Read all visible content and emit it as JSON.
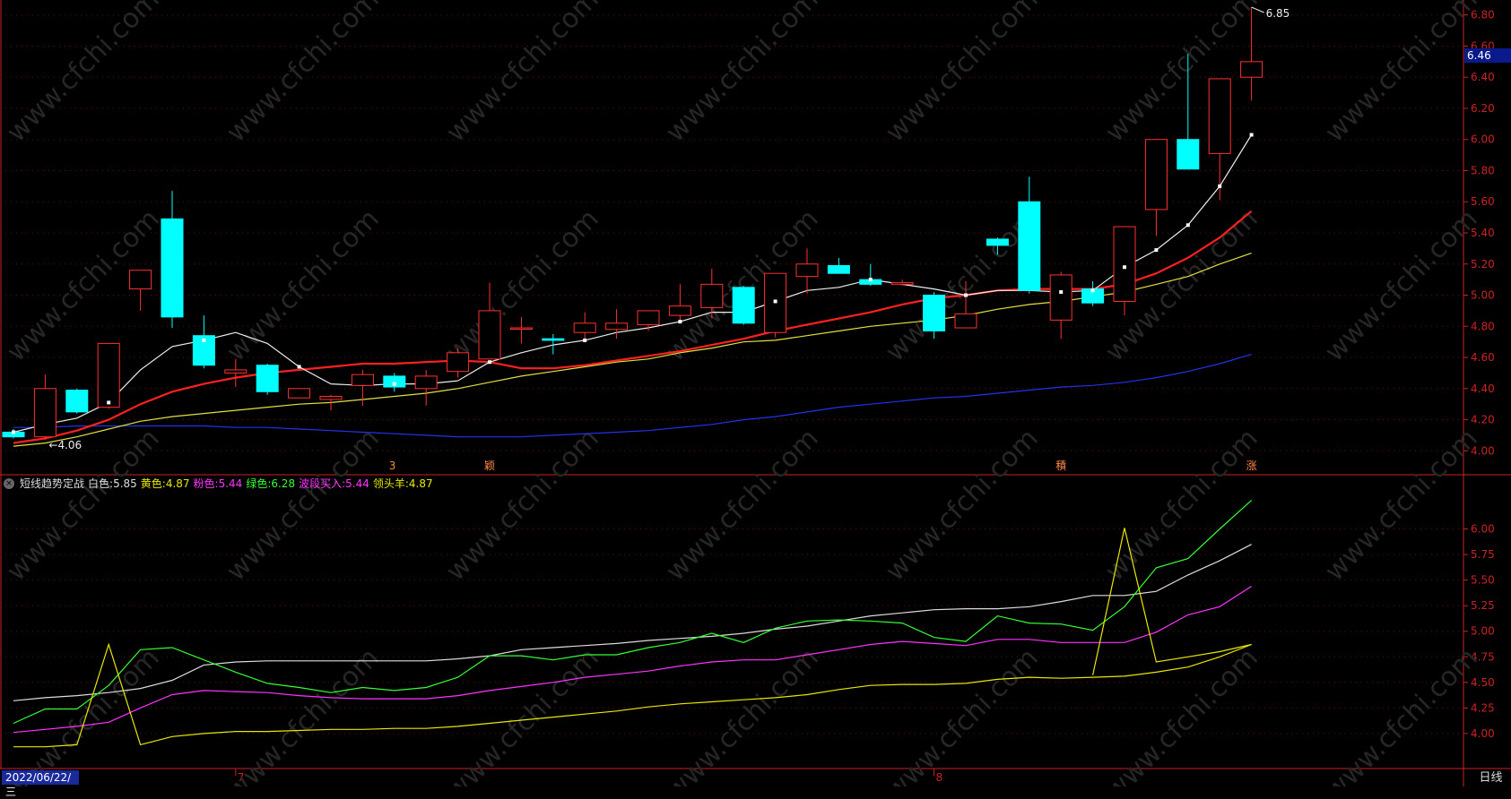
{
  "legend": {
    "title": "短线趋势定战",
    "items": [
      {
        "label": "白色:",
        "value": "5.85",
        "color": "#dddddd"
      },
      {
        "label": "黄色:",
        "value": "4.87",
        "color": "#e8e800"
      },
      {
        "label": "粉色:",
        "value": "5.44",
        "color": "#ff33ff"
      },
      {
        "label": "绿色:",
        "value": "6.28",
        "color": "#33ff33"
      },
      {
        "label": "波段买入:",
        "value": "5.44",
        "color": "#ff33ff"
      },
      {
        "label": "领头羊:",
        "value": "4.87",
        "color": "#e8e800"
      }
    ]
  },
  "date_label": "2022/06/22/三",
  "period_label": "日线",
  "current_price": "6.46",
  "colors": {
    "up": "#ff3030",
    "down": "#00ffff",
    "ma5": "#eeeeee",
    "ma10": "#ff2020",
    "ma20": "#e0e040",
    "ma60": "#2233ee",
    "axis": "#cc2222"
  },
  "chart_data": [
    {
      "type": "candlestick",
      "ylim": [
        3.95,
        6.85
      ],
      "y_ticks": [
        "6.80",
        "6.60",
        "6.40",
        "6.20",
        "6.00",
        "5.80",
        "5.60",
        "5.40",
        "5.20",
        "5.00",
        "4.80",
        "4.60",
        "4.40",
        "4.20",
        "4.00"
      ],
      "high_annotation": "6.85",
      "low_annotation": "4.06",
      "ohlc": [
        [
          4.12,
          4.14,
          4.08,
          4.09
        ],
        [
          4.09,
          4.49,
          4.07,
          4.4
        ],
        [
          4.39,
          4.4,
          4.24,
          4.25
        ],
        [
          4.28,
          4.69,
          4.27,
          4.69
        ],
        [
          5.04,
          5.16,
          4.9,
          5.16
        ],
        [
          5.49,
          5.67,
          4.79,
          4.86
        ],
        [
          4.74,
          4.87,
          4.53,
          4.55
        ],
        [
          4.5,
          4.59,
          4.41,
          4.52
        ],
        [
          4.55,
          4.56,
          4.36,
          4.38
        ],
        [
          4.34,
          4.4,
          4.34,
          4.4
        ],
        [
          4.33,
          4.36,
          4.26,
          4.35
        ],
        [
          4.42,
          4.52,
          4.29,
          4.49
        ],
        [
          4.48,
          4.5,
          4.38,
          4.41
        ],
        [
          4.4,
          4.52,
          4.29,
          4.48
        ],
        [
          4.51,
          4.66,
          4.47,
          4.63
        ],
        [
          4.59,
          5.08,
          4.59,
          4.9
        ],
        [
          4.79,
          4.86,
          4.69,
          4.79
        ],
        [
          4.72,
          4.75,
          4.62,
          4.71
        ],
        [
          4.76,
          4.89,
          4.71,
          4.82
        ],
        [
          4.78,
          4.91,
          4.72,
          4.82
        ],
        [
          4.81,
          4.9,
          4.77,
          4.9
        ],
        [
          4.87,
          5.07,
          4.83,
          4.93
        ],
        [
          4.92,
          5.17,
          4.85,
          5.07
        ],
        [
          5.05,
          5.06,
          4.81,
          4.82
        ],
        [
          4.76,
          5.14,
          4.73,
          5.14
        ],
        [
          5.12,
          5.3,
          5.01,
          5.2
        ],
        [
          5.19,
          5.24,
          5.14,
          5.14
        ],
        [
          5.1,
          5.2,
          5.06,
          5.07
        ],
        [
          5.07,
          5.1,
          5.06,
          5.08
        ],
        [
          5.0,
          5.02,
          4.72,
          4.77
        ],
        [
          4.79,
          5.09,
          4.79,
          4.88
        ],
        [
          5.36,
          5.37,
          5.26,
          5.32
        ],
        [
          5.6,
          5.76,
          5.01,
          5.03
        ],
        [
          4.84,
          5.15,
          4.72,
          5.13
        ],
        [
          5.04,
          5.09,
          4.93,
          4.95
        ],
        [
          4.96,
          5.44,
          4.87,
          5.44
        ],
        [
          5.55,
          5.99,
          5.38,
          6.0
        ],
        [
          6.0,
          6.55,
          5.81,
          5.81
        ],
        [
          5.91,
          6.37,
          5.61,
          6.39
        ],
        [
          6.4,
          6.85,
          6.25,
          6.5
        ]
      ],
      "ma5": [
        4.12,
        4.17,
        4.21,
        4.31,
        4.52,
        4.67,
        4.71,
        4.76,
        4.69,
        4.54,
        4.43,
        4.42,
        4.43,
        4.43,
        4.45,
        4.57,
        4.63,
        4.68,
        4.71,
        4.76,
        4.79,
        4.83,
        4.89,
        4.89,
        4.96,
        5.03,
        5.05,
        5.1,
        5.07,
        5.04,
        5.0,
        5.03,
        5.03,
        5.02,
        5.03,
        5.18,
        5.29,
        5.45,
        5.7,
        6.03
      ],
      "ma10": [
        4.05,
        4.08,
        4.13,
        4.2,
        4.3,
        4.38,
        4.43,
        4.47,
        4.5,
        4.52,
        4.54,
        4.56,
        4.56,
        4.57,
        4.58,
        4.57,
        4.53,
        4.53,
        4.55,
        4.58,
        4.61,
        4.64,
        4.68,
        4.72,
        4.77,
        4.81,
        4.85,
        4.89,
        4.94,
        4.98,
        5.0,
        5.03,
        5.04,
        5.04,
        5.04,
        5.07,
        5.14,
        5.24,
        5.37,
        5.54
      ],
      "ma20": [
        4.03,
        4.05,
        4.09,
        4.14,
        4.19,
        4.22,
        4.24,
        4.26,
        4.28,
        4.3,
        4.31,
        4.33,
        4.35,
        4.37,
        4.4,
        4.44,
        4.48,
        4.51,
        4.54,
        4.57,
        4.59,
        4.63,
        4.66,
        4.7,
        4.71,
        4.74,
        4.77,
        4.8,
        4.82,
        4.84,
        4.87,
        4.91,
        4.94,
        4.96,
        4.99,
        5.02,
        5.07,
        5.12,
        5.2,
        5.27
      ],
      "ma60": [
        4.15,
        4.15,
        4.16,
        4.16,
        4.16,
        4.16,
        4.16,
        4.15,
        4.15,
        4.14,
        4.13,
        4.12,
        4.11,
        4.1,
        4.09,
        4.09,
        4.09,
        4.1,
        4.11,
        4.12,
        4.13,
        4.15,
        4.17,
        4.2,
        4.22,
        4.25,
        4.28,
        4.3,
        4.32,
        4.34,
        4.35,
        4.37,
        4.39,
        4.41,
        4.42,
        4.44,
        4.47,
        4.51,
        4.56,
        4.62
      ],
      "markers": [
        {
          "index": 12,
          "text": "3"
        },
        {
          "index": 15,
          "text": "颖"
        },
        {
          "index": 33,
          "text": "積"
        },
        {
          "index": 39,
          "text": "涨"
        }
      ]
    },
    {
      "type": "line",
      "ylim": [
        3.85,
        6.25
      ],
      "y_ticks": [
        "6.00",
        "5.75",
        "5.50",
        "5.25",
        "5.00",
        "4.75",
        "4.50",
        "4.25",
        "4.00"
      ],
      "x_ticks": [
        {
          "index": 7,
          "text": "7"
        },
        {
          "index": 29,
          "text": "8"
        }
      ],
      "series": [
        {
          "name": "白色",
          "color": "#dddddd",
          "values": [
            4.32,
            4.35,
            4.37,
            4.4,
            4.44,
            4.52,
            4.67,
            4.7,
            4.71,
            4.71,
            4.71,
            4.71,
            4.71,
            4.71,
            4.73,
            4.76,
            4.82,
            4.84,
            4.86,
            4.88,
            4.91,
            4.93,
            4.95,
            4.98,
            5.02,
            5.05,
            5.1,
            5.15,
            5.18,
            5.21,
            5.22,
            5.22,
            5.24,
            5.29,
            5.35,
            5.35,
            5.39,
            5.55,
            5.69,
            5.85
          ]
        },
        {
          "name": "绿色",
          "color": "#33ff33",
          "values": [
            4.1,
            4.24,
            4.24,
            4.47,
            4.82,
            4.84,
            4.72,
            4.6,
            4.49,
            4.45,
            4.4,
            4.45,
            4.42,
            4.45,
            4.55,
            4.76,
            4.76,
            4.72,
            4.77,
            4.77,
            4.84,
            4.89,
            4.98,
            4.89,
            5.03,
            5.1,
            5.11,
            5.1,
            5.08,
            4.94,
            4.9,
            5.15,
            5.08,
            5.07,
            5.01,
            5.24,
            5.62,
            5.71,
            6.0,
            6.28
          ]
        },
        {
          "name": "粉色",
          "color": "#ff33ff",
          "values": [
            4.01,
            4.04,
            4.07,
            4.11,
            4.25,
            4.38,
            4.42,
            4.41,
            4.4,
            4.37,
            4.35,
            4.34,
            4.34,
            4.34,
            4.37,
            4.42,
            4.46,
            4.5,
            4.55,
            4.58,
            4.61,
            4.66,
            4.7,
            4.72,
            4.72,
            4.77,
            4.82,
            4.87,
            4.9,
            4.88,
            4.86,
            4.92,
            4.92,
            4.89,
            4.89,
            4.89,
            4.99,
            5.16,
            5.24,
            5.44
          ]
        },
        {
          "name": "黄色",
          "color": "#e8e800",
          "values": [
            3.87,
            3.87,
            3.89,
            4.87,
            3.89,
            3.97,
            4.0,
            4.02,
            4.02,
            4.03,
            4.04,
            4.04,
            4.05,
            4.05,
            4.07,
            4.1,
            4.13,
            4.16,
            4.19,
            4.22,
            4.26,
            4.29,
            4.31,
            4.33,
            4.35,
            4.38,
            4.43,
            4.47,
            4.48,
            4.48,
            4.49,
            4.53,
            4.55,
            4.54,
            4.55,
            4.56,
            4.6,
            4.65,
            4.75,
            4.87
          ]
        },
        {
          "name": "领头羊",
          "color": "#e8e800",
          "values": [
            null,
            null,
            null,
            null,
            null,
            null,
            null,
            null,
            null,
            null,
            null,
            null,
            null,
            null,
            null,
            null,
            null,
            null,
            null,
            null,
            null,
            null,
            null,
            null,
            null,
            null,
            null,
            null,
            null,
            null,
            null,
            null,
            null,
            null,
            4.57,
            6.01,
            4.7,
            4.75,
            4.8,
            4.87
          ]
        }
      ]
    }
  ]
}
